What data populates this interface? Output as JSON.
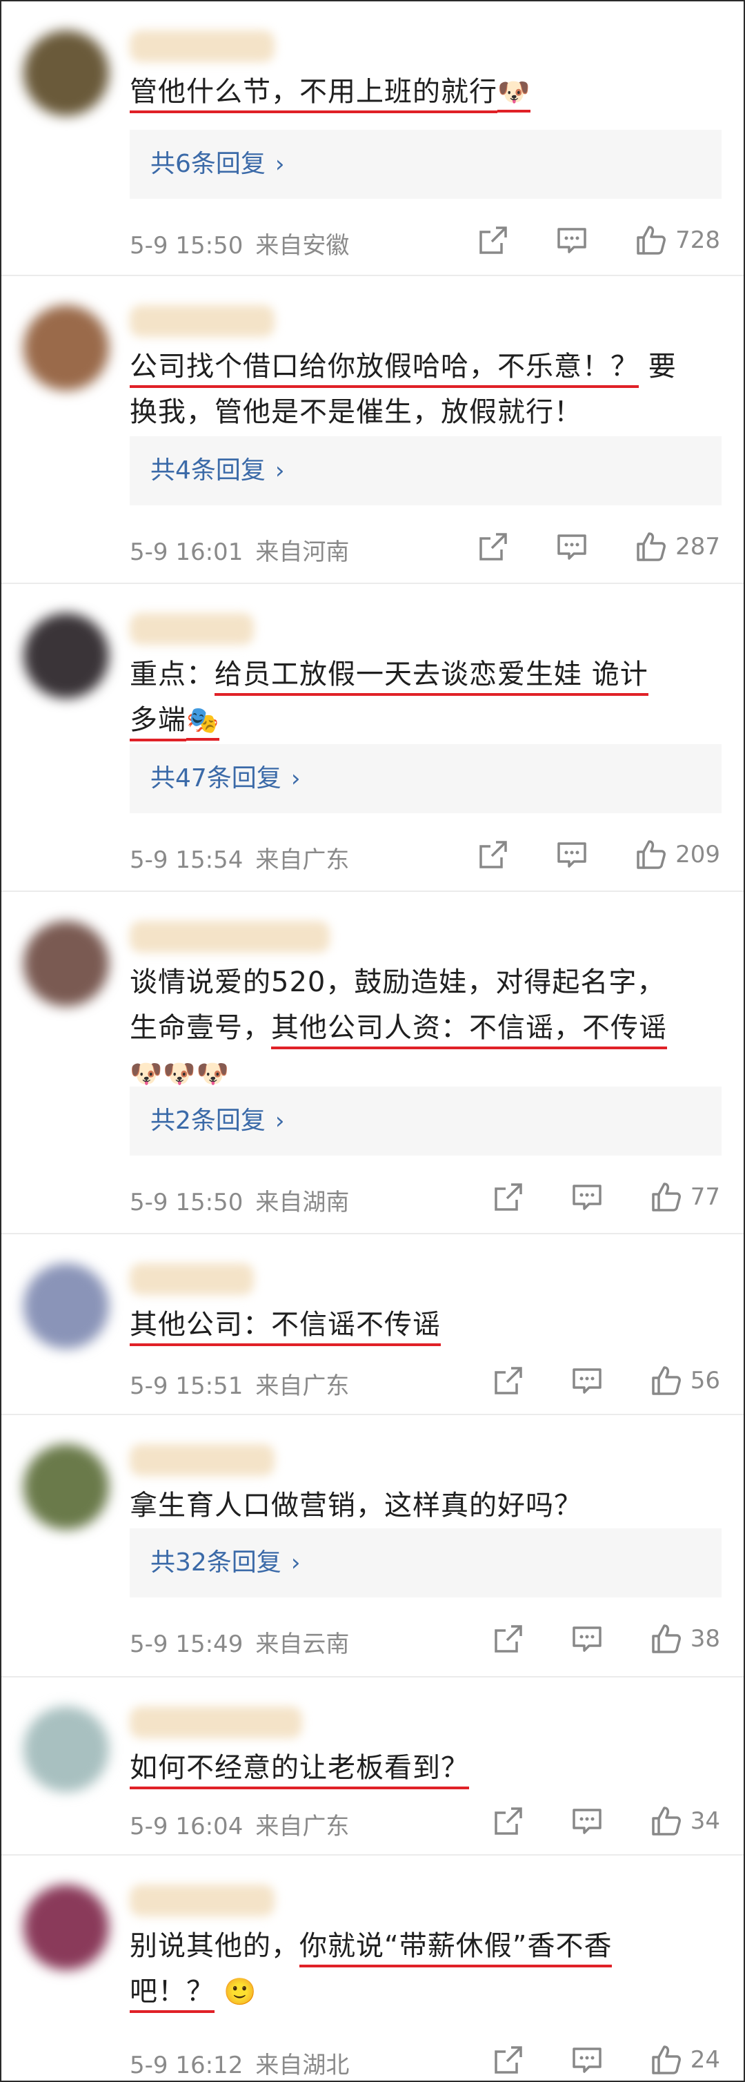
{
  "comments": [
    {
      "lines": [
        [
          {
            "t": "管他什么节，不用上班的就行",
            "u": true
          },
          {
            "t": "🐶",
            "e": true,
            "u": true
          }
        ]
      ],
      "reply": "共6条回复",
      "time": "5-9 15:50",
      "location": "来自安徽",
      "likes": "728",
      "avatar_color": "#6a5a3a"
    },
    {
      "lines": [
        [
          {
            "t": "公司找个借口给你放假哈哈，不乐意！？",
            "u": true
          },
          {
            "t": " 要",
            "u": false
          }
        ],
        [
          {
            "t": "换我，管他是不是催生，放假就行！",
            "u": false
          }
        ]
      ],
      "reply": "共4条回复",
      "time": "5-9 16:01",
      "location": "来自河南",
      "likes": "287",
      "avatar_color": "#9a6a4a"
    },
    {
      "lines": [
        [
          {
            "t": "重点：",
            "u": false
          },
          {
            "t": "给员工放假一天去谈恋爱生娃 诡计",
            "u": true
          }
        ],
        [
          {
            "t": "多端",
            "u": true
          },
          {
            "t": "🎭",
            "e": true,
            "u": true
          }
        ]
      ],
      "reply": "共47条回复",
      "time": "5-9 15:54",
      "location": "来自广东",
      "likes": "209",
      "avatar_color": "#3a3438"
    },
    {
      "lines": [
        [
          {
            "t": "谈情说爱的520，鼓励造娃，对得起名字，",
            "u": false
          }
        ],
        [
          {
            "t": "生命壹号，",
            "u": false
          },
          {
            "t": "其他公司人资：不信谣，不传谣",
            "u": true
          }
        ],
        [
          {
            "t": "🐶🐶🐶",
            "e": true,
            "u": false
          }
        ]
      ],
      "reply": "共2条回复",
      "time": "5-9 15:50",
      "location": "来自湖南",
      "likes": "77",
      "avatar_color": "#7a5a52"
    },
    {
      "lines": [
        [
          {
            "t": "其他公司：不信谣不传谣",
            "u": true
          }
        ]
      ],
      "reply": "",
      "time": "5-9 15:51",
      "location": "来自广东",
      "likes": "56",
      "avatar_color": "#8a94b8"
    },
    {
      "lines": [
        [
          {
            "t": "拿生育人口做营销，这样真的好吗？",
            "u": false
          }
        ]
      ],
      "reply": "共32条回复",
      "time": "5-9 15:49",
      "location": "来自云南",
      "likes": "38",
      "avatar_color": "#6a7a4a"
    },
    {
      "lines": [
        [
          {
            "t": "如何不经意的让老板看到？",
            "u": true
          }
        ]
      ],
      "reply": "",
      "time": "5-9 16:04",
      "location": "来自广东",
      "likes": "34",
      "avatar_color": "#a8c0c0"
    },
    {
      "lines": [
        [
          {
            "t": "别说其他的，",
            "u": false
          },
          {
            "t": "你就说“带薪休假”香不香",
            "u": true
          }
        ],
        [
          {
            "t": "吧！？",
            "u": true
          },
          {
            "t": " 🙂",
            "e": true,
            "u": false
          }
        ]
      ],
      "reply": "",
      "time": "5-9 16:12",
      "location": "来自湖北",
      "likes": "24",
      "avatar_color": "#8a3a5a"
    }
  ]
}
